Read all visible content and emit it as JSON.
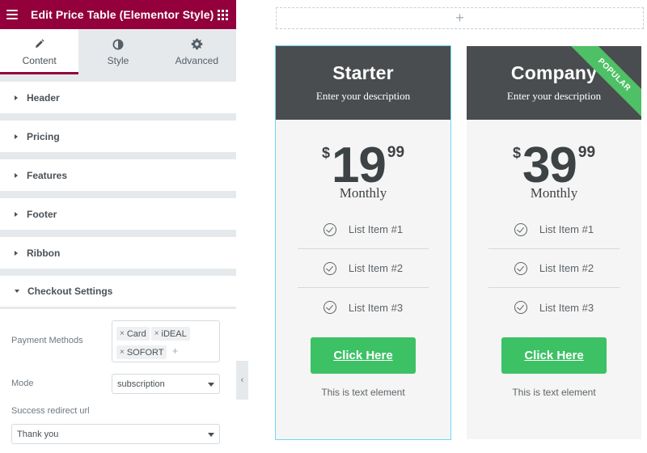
{
  "editor": {
    "title": "Edit Price Table (Elementor Style)",
    "tabs": [
      {
        "label": "Content",
        "icon": "pencil-icon",
        "active": true
      },
      {
        "label": "Style",
        "icon": "half-circle-icon",
        "active": false
      },
      {
        "label": "Advanced",
        "icon": "gear-icon",
        "active": false
      }
    ],
    "sections": [
      "Header",
      "Pricing",
      "Features",
      "Footer",
      "Ribbon"
    ],
    "open_section": "Checkout Settings",
    "checkout": {
      "payment_methods_label": "Payment Methods",
      "payment_methods": [
        "Card",
        "iDEAL",
        "SOFORT"
      ],
      "mode_label": "Mode",
      "mode_value": "subscription",
      "redirect_label": "Success redirect url",
      "redirect_value": "Thank you"
    },
    "collapse_icon": "‹"
  },
  "canvas": {
    "add_section_icon": "+",
    "cards": [
      {
        "title": "Starter",
        "description": "Enter your description",
        "currency": "$",
        "amount": "19",
        "cents": "99",
        "period": "Monthly",
        "features": [
          "List Item #1",
          "List Item #2",
          "List Item #3"
        ],
        "button": "Click Here",
        "footer": "This is text element",
        "ribbon": null
      },
      {
        "title": "Company",
        "description": "Enter your description",
        "currency": "$",
        "amount": "39",
        "cents": "99",
        "period": "Monthly",
        "features": [
          "List Item #1",
          "List Item #2",
          "List Item #3"
        ],
        "button": "Click Here",
        "footer": "This is text element",
        "ribbon": "POPULAR"
      }
    ]
  },
  "colors": {
    "brand": "#93003c",
    "header_dark": "#4a4d4f",
    "button_green": "#3dc165",
    "ribbon_green": "#4ec066",
    "selection_outline": "#71d7f7"
  }
}
